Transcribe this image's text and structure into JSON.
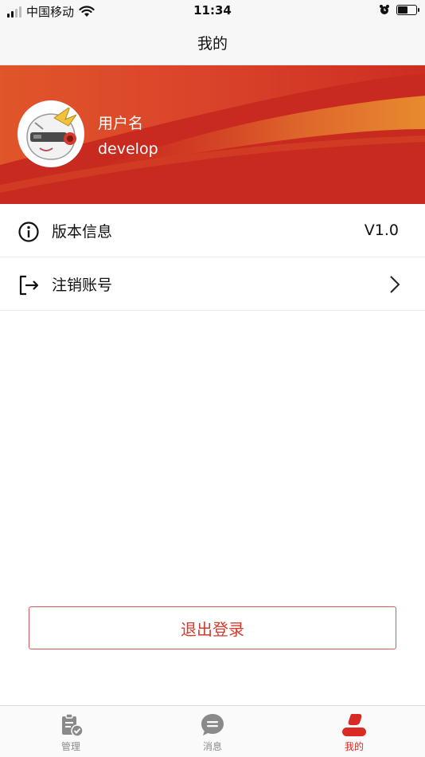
{
  "status_bar": {
    "carrier": "中国移动",
    "time": "11:34",
    "battery_level": 0.55
  },
  "nav": {
    "title": "我的"
  },
  "profile": {
    "username_label": "用户名",
    "username": "develop"
  },
  "list": {
    "items": [
      {
        "label": "版本信息",
        "value": "V1.0",
        "icon": "info-icon"
      },
      {
        "label": "注销账号",
        "icon": "logout-icon",
        "trailing": "chevron-right-icon"
      }
    ]
  },
  "logout": {
    "label": "退出登录"
  },
  "tabs": [
    {
      "label": "管理",
      "icon": "clipboard-check-icon",
      "active": false
    },
    {
      "label": "消息",
      "icon": "chat-bubble-icon",
      "active": false
    },
    {
      "label": "我的",
      "icon": "user-icon",
      "active": true
    }
  ],
  "colors": {
    "accent": "#d92b23",
    "banner": "#cf3320",
    "banner_highlight": "#e8842c"
  }
}
